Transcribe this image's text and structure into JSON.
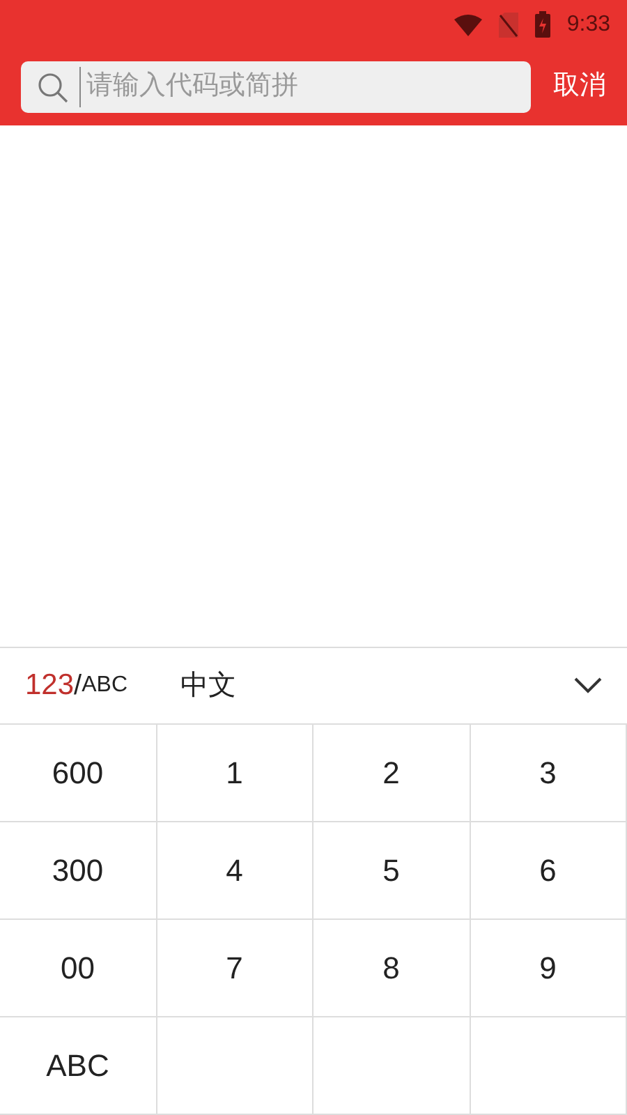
{
  "status_bar": {
    "time": "9:33"
  },
  "search": {
    "placeholder": "请输入代码或简拼",
    "cancel": "取消"
  },
  "keyboard": {
    "modes": [
      {
        "label": "123",
        "selected": true
      },
      {
        "label": "ABC",
        "selected": false
      }
    ],
    "separator": "/",
    "language": "中文",
    "rows": [
      [
        {
          "kind": "key",
          "label": "600"
        },
        {
          "kind": "key",
          "label": "1"
        },
        {
          "kind": "key",
          "label": "2"
        },
        {
          "kind": "key",
          "label": "3"
        }
      ],
      [
        {
          "kind": "key",
          "label": "300"
        },
        {
          "kind": "key",
          "label": "4"
        },
        {
          "kind": "key",
          "label": "5"
        },
        {
          "kind": "key",
          "label": "6"
        }
      ],
      [
        {
          "kind": "key",
          "label": "00"
        },
        {
          "kind": "key",
          "label": "7"
        },
        {
          "kind": "key",
          "label": "8"
        },
        {
          "kind": "key",
          "label": "9"
        }
      ],
      [
        {
          "kind": "key",
          "label": "ABC"
        },
        {
          "kind": "blank"
        },
        {
          "kind": "blank"
        },
        {
          "kind": "blank"
        }
      ]
    ]
  }
}
